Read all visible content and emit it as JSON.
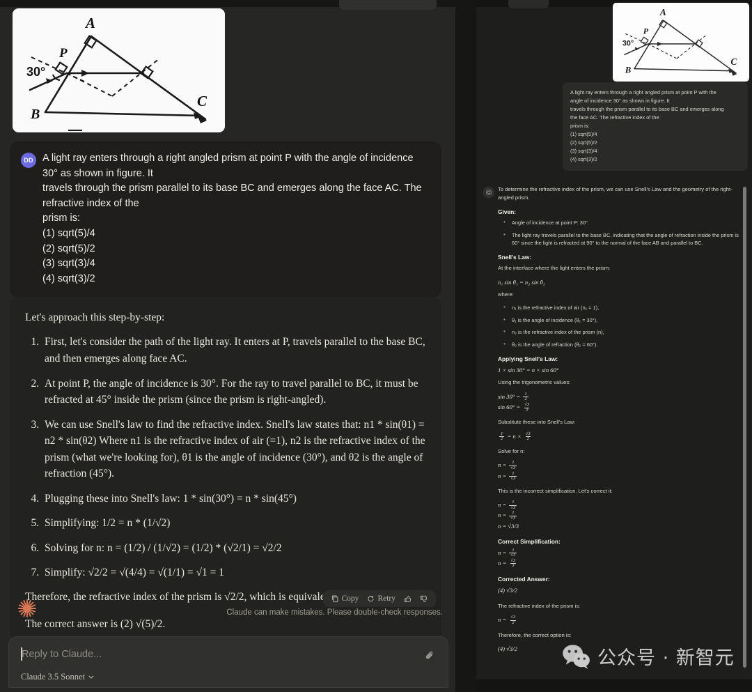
{
  "app": {
    "accent": "#d97757",
    "user_avatar_initials": "DD",
    "user_avatar_color": "#6c6ce0"
  },
  "left": {
    "user_message": "A light ray enters through a right angled prism at point P with the angle of incidence 30° as shown in figure. It\ntravels through the prism parallel to its base BC and emerges along the face AC. The refractive index of the\nprism is:\n(1) sqrt(5)/4\n(2) sqrt(5)/2\n(3) sqrt(3)/4\n(4) sqrt(3)/2",
    "assistant": {
      "intro": "Let's approach this step-by-step:",
      "steps": [
        "First, let's consider the path of the light ray. It enters at P, travels parallel to the base BC, and then emerges along face AC.",
        "At point P, the angle of incidence is 30°. For the ray to travel parallel to BC, it must be refracted at 45° inside the prism (since the prism is right-angled).",
        "We can use Snell's law to find the refractive index. Snell's law states that: n1 * sin(θ1) = n2 * sin(θ2) Where n1 is the refractive index of air (=1), n2 is the refractive index of the prism (what we're looking for), θ1 is the angle of incidence (30°), and θ2 is the angle of refraction (45°).",
        "Plugging these into Snell's law: 1 * sin(30°) = n * sin(45°)",
        "Simplifying: 1/2 = n * (1/√2)",
        "Solving for n: n = (1/2) / (1/√2) = (1/2) * (√2/1) = √2/2",
        "Simplify: √2/2 = √(4/4) = √(1/1) = √1 = 1"
      ],
      "conclusion": "Therefore, the refractive index of the prism is √2/2, which is equivalent to √(2)/2.",
      "final_answer": "The correct answer is (2) √(5)/2."
    },
    "actions": {
      "copy": "Copy",
      "retry": "Retry"
    },
    "disclaimer": "Claude can make mistakes. Please double-check responses.",
    "composer": {
      "placeholder": "Reply to Claude...",
      "model": "Claude 3.5 Sonnet"
    }
  },
  "right": {
    "user_message": "A light ray enters through a right angled prism at point P with the\nangle of incidence 30° as shown in figure. It\ntravels through the prism parallel to its base BC and emerges along\nthe face AC. The refractive index of the\nprism is:\n(1) sqrt(5)/4\n(2) sqrt(5)/2\n(3) sqrt(3)/4\n(4) sqrt(3)/2",
    "assistant": {
      "intro": "To determine the refractive index of the prism, we can use Snell's Law and the geometry of the right-angled prism.",
      "given_heading": "Given:",
      "given_items": [
        "Angle of incidence at point P: 30°",
        "The light ray travels parallel to the base BC, indicating that the angle of refraction inside the prism is 60° since the light is refracted at 90° to the normal of the face AB and parallel to BC."
      ],
      "snell_heading": "Snell's Law:",
      "snell_intro": "At the interface where the light enters the prism:",
      "snell_eq": "n₁ sin θ₁ = n₂ sin θ₂",
      "where_label": "where:",
      "where_items": [
        "n₁ is the refractive index of air (n₁ = 1),",
        "θ₁ is the angle of incidence (θ₁ = 30°),",
        "n₂ is the refractive index of the prism (n),",
        "θ₂ is the angle of refraction (θ₂ = 60°)."
      ],
      "applying_heading": "Applying Snell's Law:",
      "applying_eq": "1 × sin 30° = n × sin 60°",
      "trig_intro": "Using the trigonometric values:",
      "trig_eq1_lhs": "sin 30° =",
      "trig_eq1_num": "1",
      "trig_eq1_den": "2",
      "trig_eq2_lhs": "sin 60° =",
      "trig_eq2_num": "√3",
      "trig_eq2_den": "2",
      "substitute_intro": "Substitute these into Snell's Law:",
      "substitute_lhs_num": "1",
      "substitute_lhs_den": "2",
      "substitute_mid": "= n ×",
      "substitute_rhs_num": "√3",
      "substitute_rhs_den": "2",
      "solve_intro": "Solve for n:",
      "solve_eq1_num": "1",
      "solve_eq1_den": "√3",
      "solve_eq2_num": "1",
      "solve_eq2_den": "√3",
      "incorrect_note": "This is the incorrect simplification. Let's correct it:",
      "correct3": "n = √3/3",
      "correct_heading": "Correct Simplification:",
      "cs_eq1_num": "1",
      "cs_eq1_den": "√3",
      "cs_eq2_num": "√3",
      "cs_eq2_den": "3",
      "answer_heading": "Corrected Answer:",
      "answer_value": "(4) √3/2",
      "closing_intro": "The refractive index of the prism is:",
      "closing_num": "√3",
      "closing_den": "2",
      "closing_therefore": "Therefore, the correct option is:",
      "closing_answer": "(4) √3/2",
      "n_label": "n ="
    }
  },
  "watermark": {
    "text": "公众号 · 新智元",
    "logo": "wechat-icon"
  },
  "diagram": {
    "labels": {
      "A": "A",
      "B": "B",
      "C": "C",
      "P": "P",
      "angle": "30°"
    }
  }
}
